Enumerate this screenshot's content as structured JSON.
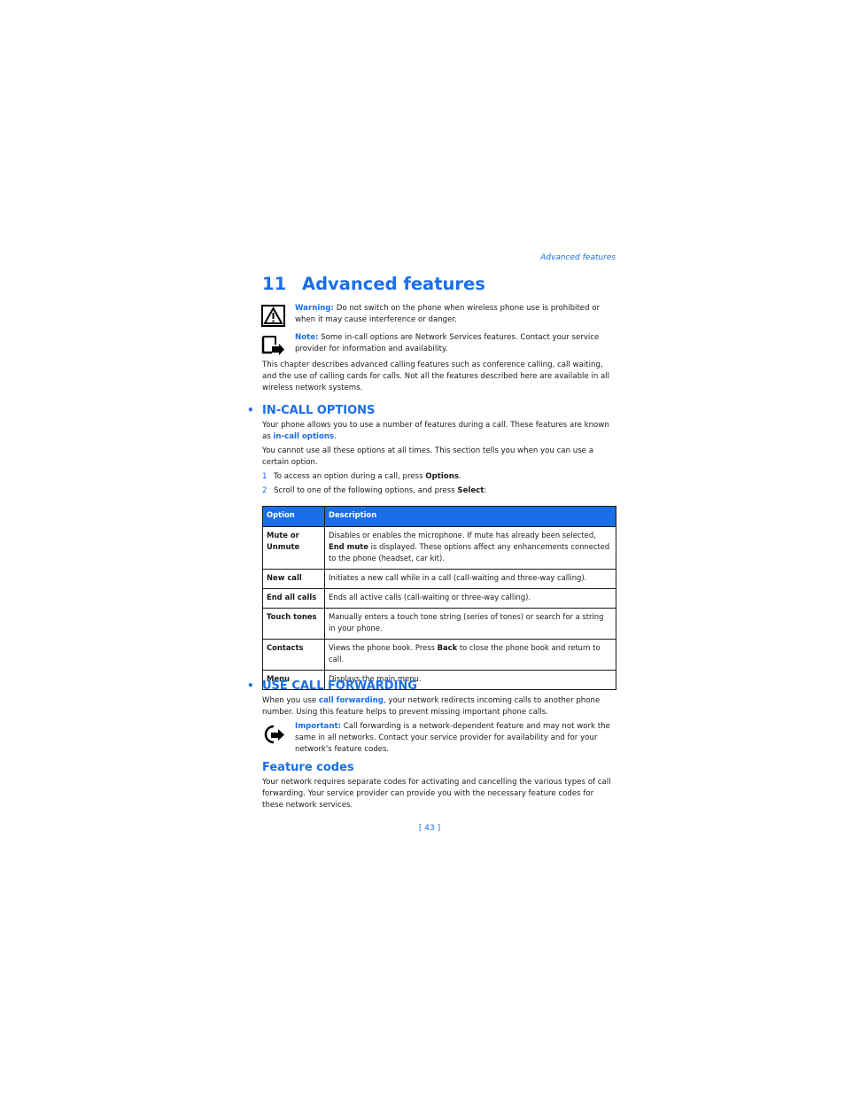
{
  "running_head": "Advanced features",
  "chapter": {
    "number": "11",
    "title": "Advanced features"
  },
  "warning": {
    "icon": "warning-triangle-icon",
    "label": "Warning:",
    "text": " Do not switch on the phone when wireless phone use is prohibited or when it may cause interference or danger."
  },
  "note": {
    "icon": "note-hand-icon",
    "label": "Note:",
    "text": " Some in-call options are Network Services features. Contact your service provider for information and availability."
  },
  "intro": "This chapter describes advanced calling features such as conference calling, call waiting, and the use of calling cards for calls. Not all the features described here are available in all wireless network systems.",
  "in_call": {
    "bullet": "•",
    "title": "IN-CALL OPTIONS",
    "p1_pre": "Your phone allows you to use a number of features during a call. These features are known as ",
    "p1_link": "in-call options",
    "p1_post": ".",
    "p2": "You cannot use all these options at all times. This section tells you when you can use a certain option.",
    "steps": [
      {
        "n": "1",
        "pre": "To access an option during a call, press ",
        "bold": "Options",
        "post": "."
      },
      {
        "n": "2",
        "pre": "Scroll to one of the following options, and press ",
        "bold": "Select",
        "post": ":"
      }
    ],
    "table": {
      "headers": [
        "Option",
        "Description"
      ],
      "rows": [
        {
          "option": "Mute or Unmute",
          "desc_pre": "Disables or enables the microphone. If mute has already been selected, ",
          "desc_bold": "End mute",
          "desc_post": " is displayed. These options affect any enhancements connected to the phone (headset, car kit)."
        },
        {
          "option": "New call",
          "desc_pre": "Initiates a new call while in a call (call-waiting and three-way calling).",
          "desc_bold": "",
          "desc_post": ""
        },
        {
          "option": "End all calls",
          "desc_pre": "Ends all active calls (call-waiting or three-way calling).",
          "desc_bold": "",
          "desc_post": ""
        },
        {
          "option": "Touch tones",
          "desc_pre": "Manually enters a touch tone string (series of tones) or search for a string in your phone.",
          "desc_bold": "",
          "desc_post": ""
        },
        {
          "option": "Contacts",
          "desc_pre": "Views the phone book. Press ",
          "desc_bold": "Back",
          "desc_post": " to close the phone book and return to call."
        },
        {
          "option": "Menu",
          "desc_pre": "Displays the main menu.",
          "desc_bold": "",
          "desc_post": ""
        }
      ]
    }
  },
  "forwarding": {
    "bullet": "•",
    "title": "USE CALL FORWARDING",
    "p_pre": "When you use ",
    "p_link": "call forwarding",
    "p_post": ", your network redirects incoming calls to another phone number. Using this feature helps to prevent missing important phone calls.",
    "important": {
      "icon": "important-hand-icon",
      "label": "Important:",
      "text": " Call forwarding is a network-dependent feature and may not work the same in all networks. Contact your service provider for availability and for your network's feature codes."
    }
  },
  "feature_codes": {
    "title": "Feature codes",
    "text": "Your network requires separate codes for activating and cancelling the various types of call forwarding. Your service provider can provide you with the necessary feature codes for these network services."
  },
  "page_number": "[ 43 ]"
}
